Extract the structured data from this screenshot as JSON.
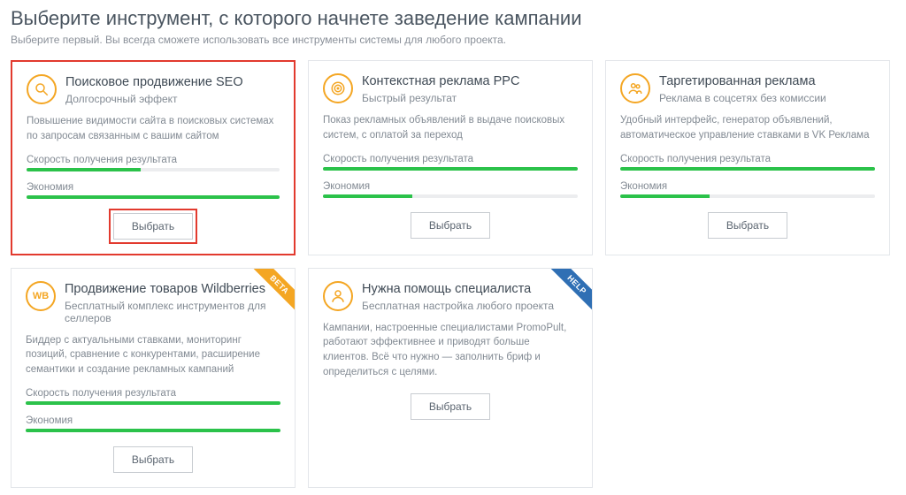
{
  "header": {
    "title": "Выберите инструмент, с которого начнете заведение кампании",
    "subtitle": "Выберите первый. Вы всегда сможете использовать все инструменты системы для любого проекта."
  },
  "common": {
    "metric_speed": "Скорость получения результата",
    "metric_economy": "Экономия",
    "select_label": "Выбрать"
  },
  "cards": [
    {
      "icon": "magnifier-icon",
      "title": "Поисковое продвижение SEO",
      "subtitle": "Долгосрочный эффект",
      "desc": "Повышение видимости сайта в поисковых системах по запросам связанным с вашим сайтом",
      "speed_pct": 45,
      "economy_pct": 100,
      "highlighted": true
    },
    {
      "icon": "target-icon",
      "title": "Контекстная реклама PPC",
      "subtitle": "Быстрый результат",
      "desc": "Показ рекламных объявлений в выдаче поисковых систем, с оплатой за переход",
      "speed_pct": 100,
      "economy_pct": 35
    },
    {
      "icon": "people-icon",
      "title": "Таргетированная реклама",
      "subtitle": "Реклама в соцсетях без комиссии",
      "desc": "Удобный интерфейс, генератор объявлений, автоматическое управление ставками в VK Реклама",
      "speed_pct": 100,
      "economy_pct": 35
    },
    {
      "icon": "wb-icon",
      "title": "Продвижение товаров Wildberries",
      "subtitle": "Бесплатный комплекс инструментов для селлеров",
      "desc": "Биддер с актуальными ставками, мониторинг позиций, сравнение с конкурентами, расширение семантики и создание рекламных кампаний",
      "speed_pct": 100,
      "economy_pct": 100,
      "ribbon": "BETA",
      "ribbon_class": "beta"
    },
    {
      "icon": "person-icon",
      "title": "Нужна помощь специалиста",
      "subtitle": "Бесплатная настройка любого проекта",
      "desc": "Кампании, настроенные специалистами PromoPult, работают эффективнее и приводят больше клиентов. Всё что нужно — заполнить бриф и определиться с целями.",
      "no_metrics": true,
      "ribbon": "HELP",
      "ribbon_class": "help"
    }
  ]
}
